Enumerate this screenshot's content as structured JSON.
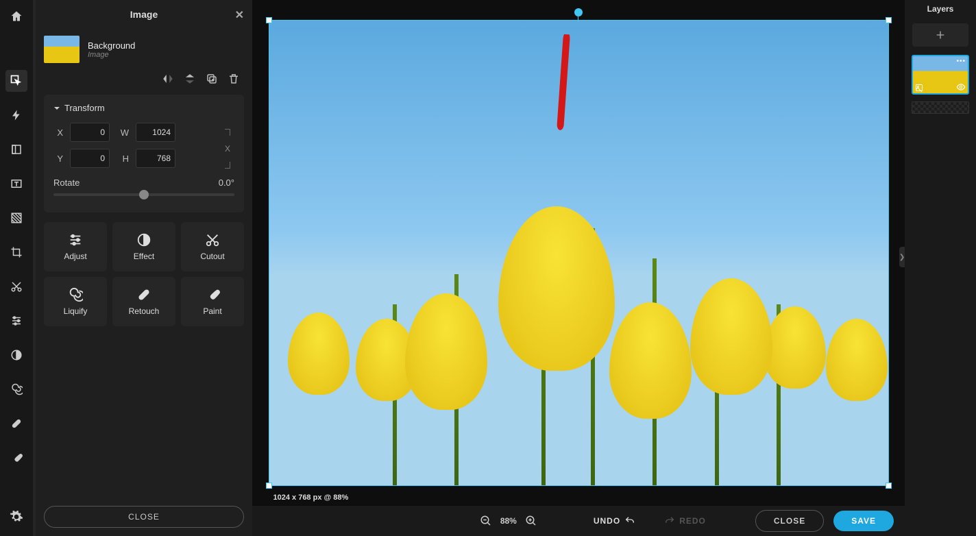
{
  "toolbar": {
    "tools": [
      "home",
      "arrange",
      "bolt",
      "frame",
      "text",
      "pattern",
      "crop",
      "cut",
      "adjust",
      "contrast",
      "liquify",
      "retouch",
      "paint",
      "settings"
    ]
  },
  "panel": {
    "title": "Image",
    "layer": {
      "name": "Background",
      "type": "Image"
    },
    "transform": {
      "title": "Transform",
      "x_label": "X",
      "x": "0",
      "y_label": "Y",
      "y": "0",
      "w_label": "W",
      "w": "1024",
      "h_label": "H",
      "h": "768",
      "lock_label": "X",
      "rotate_label": "Rotate",
      "rotate_value": "0.0°"
    },
    "tools": {
      "adjust": "Adjust",
      "effect": "Effect",
      "cutout": "Cutout",
      "liquify": "Liquify",
      "retouch": "Retouch",
      "paint": "Paint"
    },
    "close": "CLOSE"
  },
  "canvas": {
    "status": "1024 x 768 px @ 88%"
  },
  "bottom": {
    "zoom": "88%",
    "undo": "UNDO",
    "redo": "REDO",
    "close": "CLOSE",
    "save": "SAVE"
  },
  "layers": {
    "title": "Layers"
  }
}
